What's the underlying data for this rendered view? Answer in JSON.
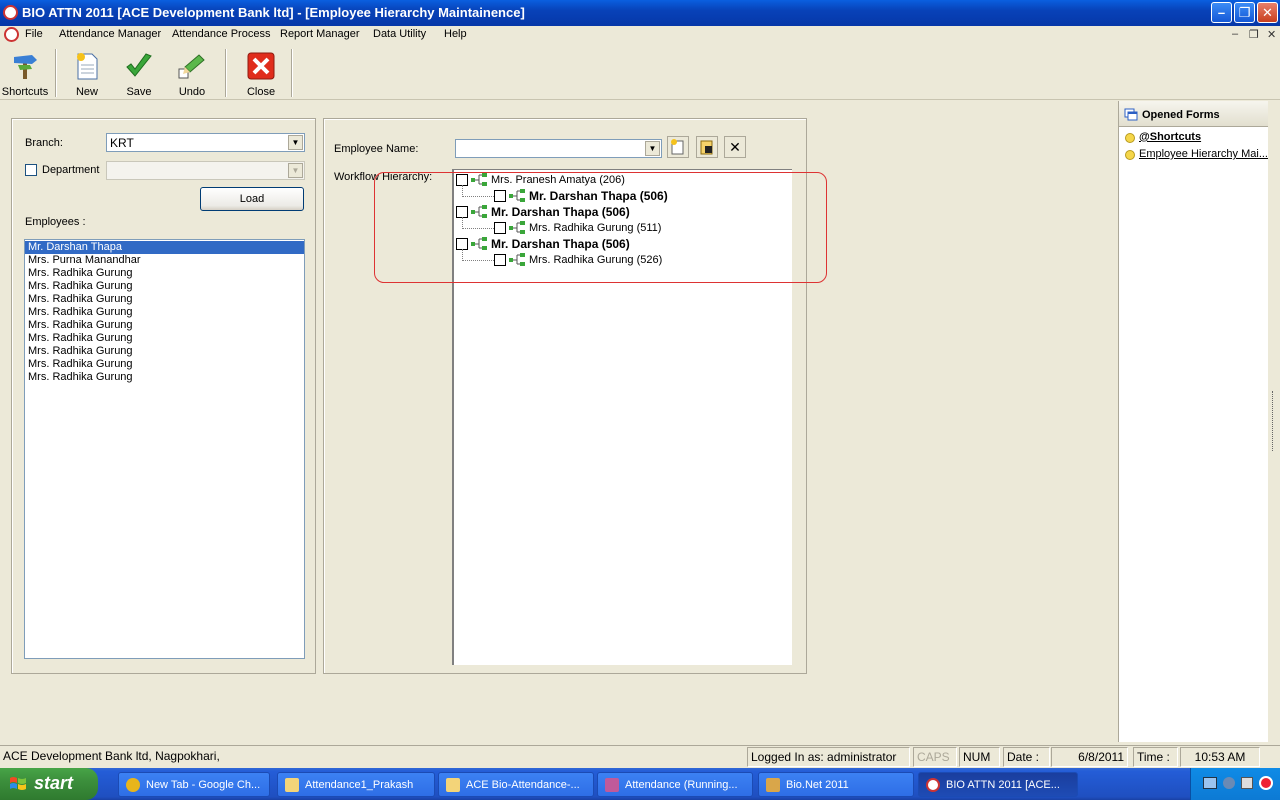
{
  "window": {
    "title": "BIO ATTN 2011  [ACE Development Bank ltd] - [Employee Hierarchy Maintainence]"
  },
  "menu": [
    "File",
    "Attendance Manager",
    "Attendance Process",
    "Report  Manager",
    "Data Utility",
    "Help"
  ],
  "toolbar": {
    "shortcuts": "Shortcuts",
    "new": "New",
    "save": "Save",
    "undo": "Undo",
    "close": "Close"
  },
  "left": {
    "branch_label": "Branch:",
    "branch_value": "KRT",
    "department_label": "Department",
    "department_value": "",
    "load": "Load",
    "employees_label": "Employees :",
    "employees": [
      "Mr. Darshan Thapa",
      "Mrs. Purna  Manandhar",
      "Mrs. Radhika Gurung",
      "Mrs. Radhika Gurung",
      "Mrs. Radhika Gurung",
      "Mrs. Radhika Gurung",
      "Mrs. Radhika Gurung",
      "Mrs. Radhika Gurung",
      "Mrs. Radhika Gurung",
      "Mrs. Radhika Gurung",
      "Mrs. Radhika Gurung"
    ],
    "selected_index": 0
  },
  "right": {
    "employee_name_label": "Employee Name:",
    "employee_name_value": "",
    "workflow_label": "Workflow Hierarchy:",
    "tree": [
      {
        "text": "Mrs. Pranesh  Amatya (206)",
        "level": 0,
        "bold": false
      },
      {
        "text": "Mr. Darshan Thapa (506)",
        "level": 1,
        "bold": true
      },
      {
        "text": "Mr. Darshan Thapa (506)",
        "level": 0,
        "bold": true
      },
      {
        "text": "Mrs. Radhika Gurung (511)",
        "level": 1,
        "bold": false
      },
      {
        "text": "Mr. Darshan Thapa (506)",
        "level": 0,
        "bold": true
      },
      {
        "text": "Mrs. Radhika Gurung (526)",
        "level": 1,
        "bold": false
      }
    ]
  },
  "opened_forms": {
    "title": "Opened Forms",
    "items": [
      "@Shortcuts",
      "Employee Hierarchy Mai..."
    ]
  },
  "status": {
    "company": "ACE Development Bank ltd, Nagpokhari,",
    "logged_in": "Logged In as: administrator",
    "caps": "CAPS",
    "num": "NUM",
    "date_label": "Date :",
    "date_value": "6/8/2011",
    "time_label": "Time :",
    "time_value": "10:53 AM"
  },
  "taskbar": {
    "start": "start",
    "tasks": [
      "New Tab - Google Ch...",
      "Attendance1_Prakash",
      "ACE Bio-Attendance-...",
      "Attendance (Running...",
      "Bio.Net 2011",
      "BIO ATTN 2011  [ACE..."
    ],
    "active_index": 5
  },
  "colors": {
    "selection": "#316ac5",
    "highlight_box": "#d33333",
    "title_bar": "#0842b8"
  }
}
